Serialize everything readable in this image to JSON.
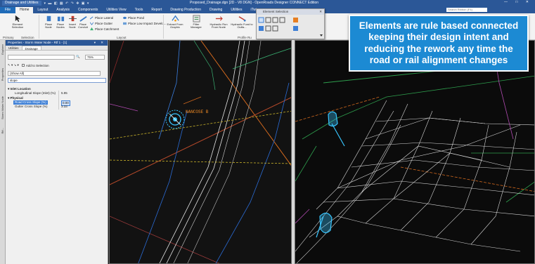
{
  "titlebar": {
    "workspace": "Drainage and Utilities",
    "title": "Proposed_Drainage.dgn [2D - V8 DGN] - OpenRoads Designer CONNECT Edition",
    "quick_access": "▾ ▬ ◧ ▦ ↶ ↷ ✥ ▣ ▾",
    "window_controls": "— □ ✕"
  },
  "ribbon": {
    "tabs": [
      "File",
      "Home",
      "Layout",
      "Analysis",
      "Components",
      "Utilities View",
      "Tools",
      "Report",
      "Drawing Production",
      "Drawing",
      "Utilities",
      "iTwin"
    ],
    "active_tab": "Home",
    "search_placeholder": "Search Ribbon (F4)",
    "buttons": {
      "element_selection": "Element Selection",
      "place_node": "Place Node",
      "place_nodes": "Place Nodes",
      "insert_node": "Insert Node",
      "place_conduit": "Place Conduit",
      "place_lateral": "Place Lateral",
      "place_gutter": "Place Gutter",
      "place_catchment": "Place Catchment",
      "place_pond": "Place Pond",
      "place_low_impact": "Place Low Impact Develo...",
      "extract_from_graphic": "Extract From Graphic",
      "filter_manager": "Filter Manager",
      "hydraulic_run_from_node": "Hydraulic Run From Node",
      "hydraulic_fund_to_outfall": "Hydraulic Fund to Outfa...",
      "profile_run": "Profile Ru"
    },
    "groups": {
      "primary": "Primary",
      "selection": "Selection",
      "layout": "Layout"
    }
  },
  "element_selection_toolbar": {
    "title": "Element Selection"
  },
  "left_strip": {
    "labels": [
      "Explorer",
      "Properties",
      "Storm Water Node",
      "Rtf..."
    ]
  },
  "properties": {
    "title": "Properties - Storm Water Node - Rtf 1 - [1]",
    "tabs": [
      "Utilities",
      "Drainage"
    ],
    "active_tab": "Drainage",
    "add_to_selection": "Add to Selection",
    "zoom_value": "75%",
    "show_combo": "(Show All)",
    "filter_value": "slope",
    "sections": {
      "inlet_location": "Inlet Location",
      "physical": "Physical"
    },
    "rows": [
      {
        "name": "Longitudinal Slope (Inlet) (%)",
        "value": "5.95"
      },
      {
        "name": "Road Cross Slope (%)",
        "value": "0.00"
      },
      {
        "name": "Gutter Cross Slope (%)",
        "value": "3.33"
      }
    ]
  },
  "views": {
    "view1_title": "View 1, Default",
    "view2_title": "View 1, Default 2D",
    "node_label": "NANCOSE B"
  },
  "callout": {
    "lines": [
      "Elements are rule based connected",
      "keeping their design intent and",
      "reducing the rework any time the",
      "road or rail alignment changes"
    ]
  },
  "colors": {
    "titlebar": "#2b5797",
    "callout": "#1c8ad3",
    "node_highlight": "#38c6ff"
  }
}
